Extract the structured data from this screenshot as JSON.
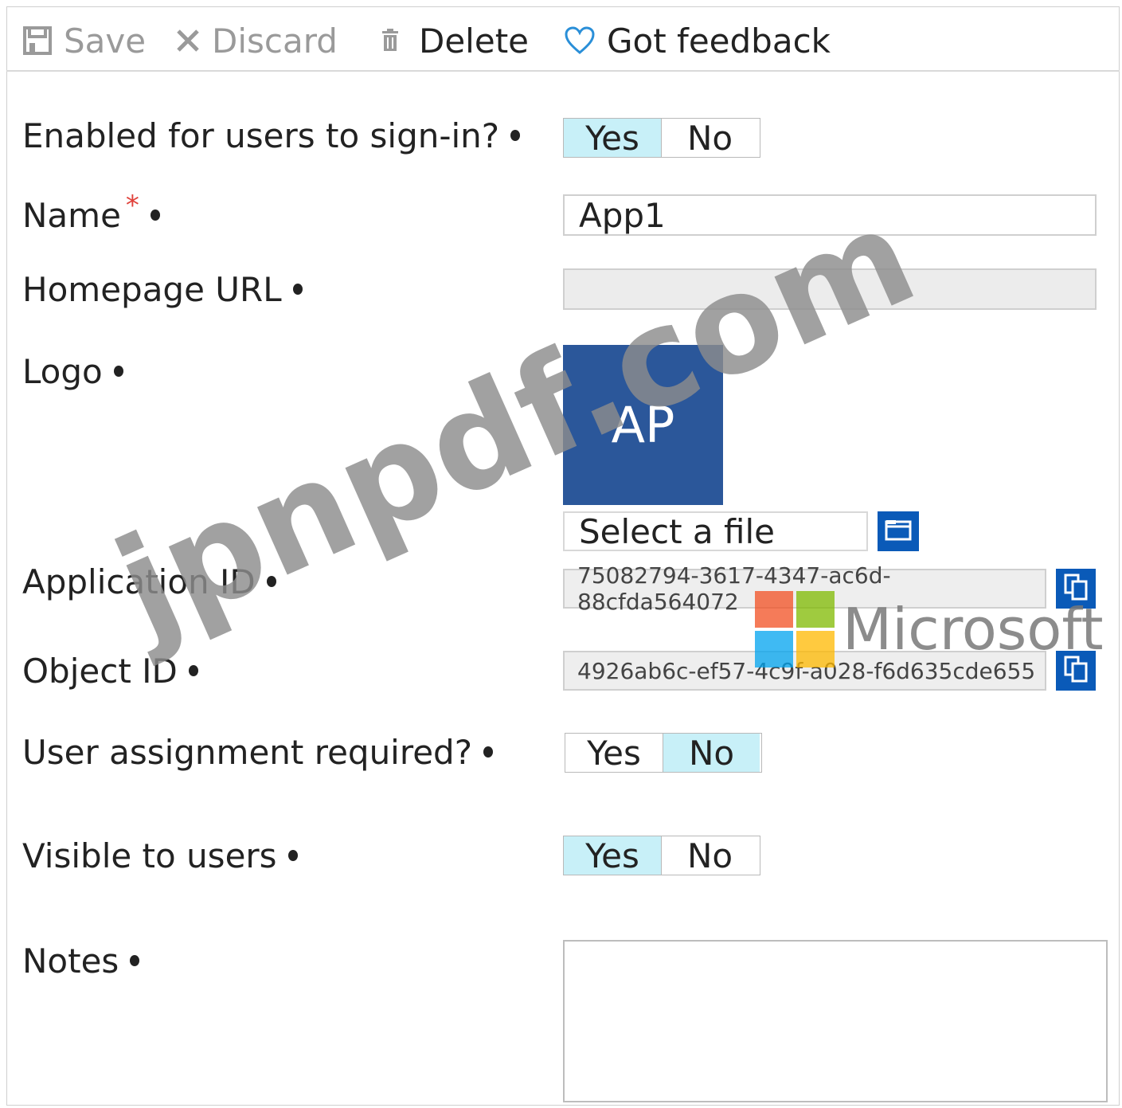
{
  "toolbar": {
    "save_label": "Save",
    "discard_label": "Discard",
    "delete_label": "Delete",
    "feedback_label": "Got feedback"
  },
  "form": {
    "enabled": {
      "label": "Enabled for users to sign-in?",
      "yes": "Yes",
      "no": "No",
      "selected": "Yes"
    },
    "name": {
      "label": "Name",
      "required_mark": "*",
      "value": "App1"
    },
    "homepage": {
      "label": "Homepage URL",
      "value": ""
    },
    "logo": {
      "label": "Logo",
      "tile_text": "AP",
      "tile_color": "#2b579a",
      "file_placeholder": "Select a file"
    },
    "app_id": {
      "label": "Application ID",
      "value": "75082794-3617-4347-ac6d-88cfda564072"
    },
    "object_id": {
      "label": "Object ID",
      "value": "4926ab6c-ef57-4c9f-a028-f6d635cde655"
    },
    "user_assignment": {
      "label": "User assignment required?",
      "yes": "Yes",
      "no": "No",
      "selected": "No"
    },
    "visible": {
      "label": "Visible to users",
      "yes": "Yes",
      "no": "No",
      "selected": "Yes"
    },
    "notes": {
      "label": "Notes",
      "value": ""
    }
  },
  "watermark": {
    "text": "jpnpdf.com",
    "brand": "Microsoft"
  },
  "colors": {
    "accent": "#0a5ab8",
    "toggle_selected": "#c8f0f8",
    "required": "#e0413a"
  }
}
